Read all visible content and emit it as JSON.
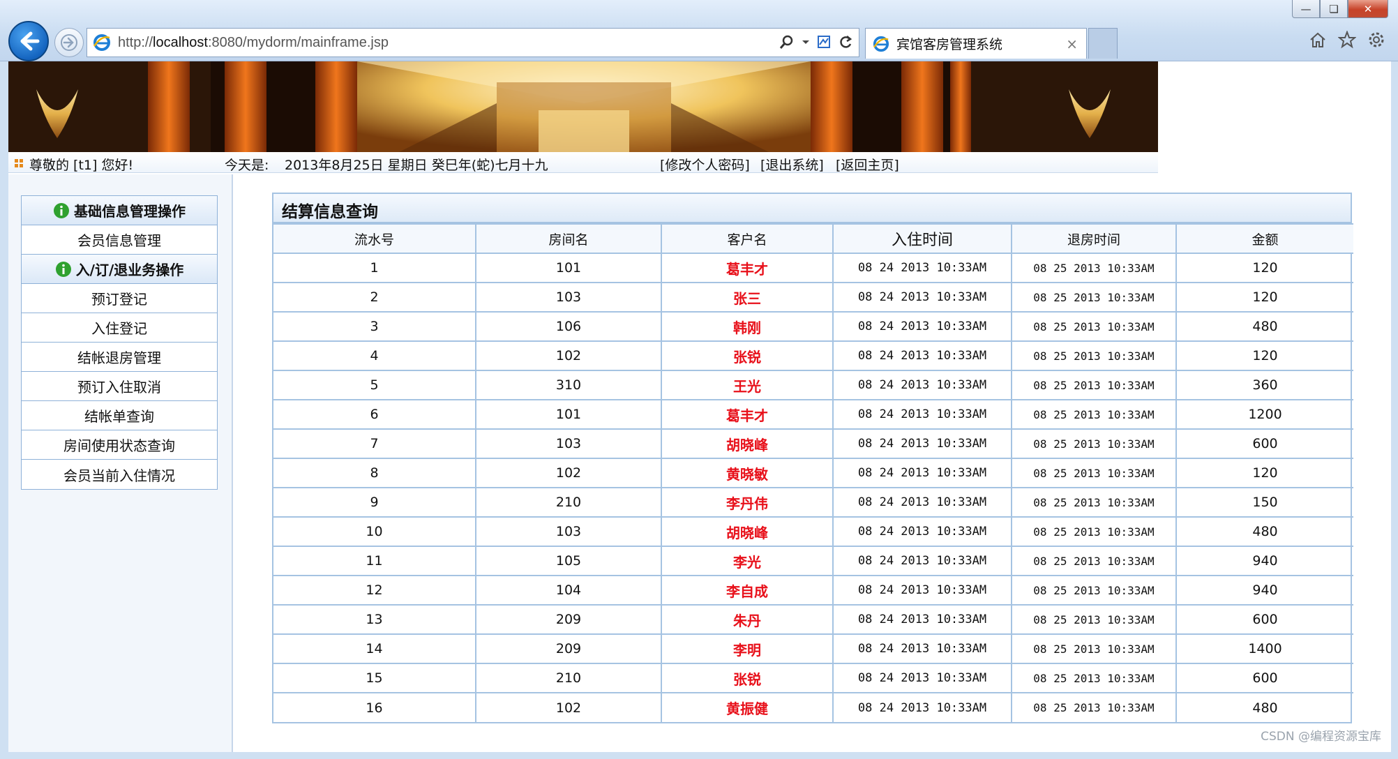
{
  "browser": {
    "url_prefix": "http://",
    "url_host": "localhost",
    "url_rest": ":8080/mydorm/mainframe.jsp",
    "tab_title": "宾馆客房管理系统",
    "tab_close": "×"
  },
  "header": {
    "greeting": "尊敬的 [t1] 您好!",
    "date_label": "今天是:",
    "date_text": "2013年8月25日 星期日 癸巳年(蛇)七月十九",
    "link_change_password": "[修改个人密码]",
    "link_logout": "[退出系统]",
    "link_home": "[返回主页]"
  },
  "sidebar": {
    "section1_title": "基础信息管理操作",
    "section1_items": [
      "会员信息管理"
    ],
    "section2_title": "入/订/退业务操作",
    "section2_items": [
      "预订登记",
      "入住登记",
      "结帐退房管理",
      "预订入住取消",
      "结帐单查询",
      "房间使用状态查询",
      "会员当前入住情况"
    ]
  },
  "panel": {
    "title": "结算信息查询",
    "columns": [
      "流水号",
      "房间名",
      "客户名",
      "入住时间",
      "退房时间",
      "金额"
    ],
    "rows": [
      [
        "1",
        "101",
        "葛丰才",
        "08 24 2013 10:33AM",
        "08 25 2013 10:33AM",
        "120"
      ],
      [
        "2",
        "103",
        "张三",
        "08 24 2013 10:33AM",
        "08 25 2013 10:33AM",
        "120"
      ],
      [
        "3",
        "106",
        "韩刚",
        "08 24 2013 10:33AM",
        "08 25 2013 10:33AM",
        "480"
      ],
      [
        "4",
        "102",
        "张锐",
        "08 24 2013 10:33AM",
        "08 25 2013 10:33AM",
        "120"
      ],
      [
        "5",
        "310",
        "王光",
        "08 24 2013 10:33AM",
        "08 25 2013 10:33AM",
        "360"
      ],
      [
        "6",
        "101",
        "葛丰才",
        "08 24 2013 10:33AM",
        "08 25 2013 10:33AM",
        "1200"
      ],
      [
        "7",
        "103",
        "胡晓峰",
        "08 24 2013 10:33AM",
        "08 25 2013 10:33AM",
        "600"
      ],
      [
        "8",
        "102",
        "黄晓敏",
        "08 24 2013 10:33AM",
        "08 25 2013 10:33AM",
        "120"
      ],
      [
        "9",
        "210",
        "李丹伟",
        "08 24 2013 10:33AM",
        "08 25 2013 10:33AM",
        "150"
      ],
      [
        "10",
        "103",
        "胡晓峰",
        "08 24 2013 10:33AM",
        "08 25 2013 10:33AM",
        "480"
      ],
      [
        "11",
        "105",
        "李光",
        "08 24 2013 10:33AM",
        "08 25 2013 10:33AM",
        "940"
      ],
      [
        "12",
        "104",
        "李自成",
        "08 24 2013 10:33AM",
        "08 25 2013 10:33AM",
        "940"
      ],
      [
        "13",
        "209",
        "朱丹",
        "08 24 2013 10:33AM",
        "08 25 2013 10:33AM",
        "600"
      ],
      [
        "14",
        "209",
        "李明",
        "08 24 2013 10:33AM",
        "08 25 2013 10:33AM",
        "1400"
      ],
      [
        "15",
        "210",
        "张锐",
        "08 24 2013 10:33AM",
        "08 25 2013 10:33AM",
        "600"
      ],
      [
        "16",
        "102",
        "黄振健",
        "08 24 2013 10:33AM",
        "08 25 2013 10:33AM",
        "480"
      ]
    ]
  },
  "watermark": "CSDN @编程资源宝库",
  "colors": {
    "customer_name": "#e8101a",
    "table_border": "#a5c3e2",
    "header_bg": "#deeaf7",
    "info_icon": "#2fa12f"
  },
  "icons": {
    "back": "arrow-left-icon",
    "forward": "arrow-right-icon",
    "ie": "internet-explorer-icon",
    "search": "search-icon",
    "refresh": "refresh-icon",
    "compat": "compatibility-view-icon",
    "home": "home-icon",
    "favorites": "star-icon",
    "settings": "gear-icon",
    "section": "info-icon"
  }
}
